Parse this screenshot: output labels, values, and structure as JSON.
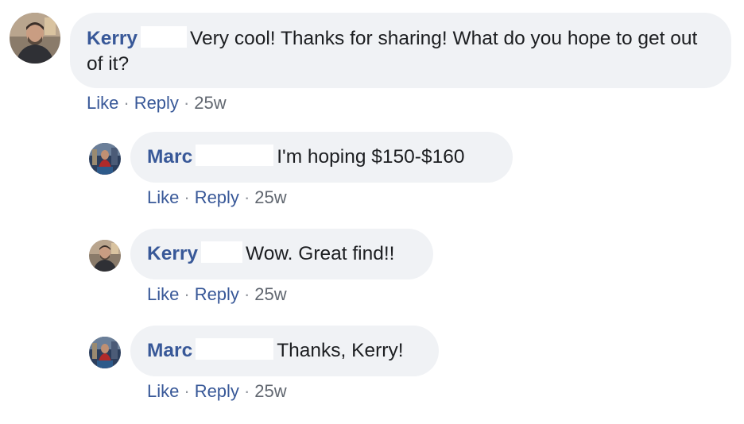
{
  "comments": [
    {
      "author": "Kerry",
      "text": "Very cool! Thanks for sharing! What do you hope to get out of it?",
      "actions": {
        "like": "Like",
        "reply": "Reply",
        "time": "25w"
      }
    },
    {
      "author": "Marc",
      "text": "I'm hoping $150-$160",
      "actions": {
        "like": "Like",
        "reply": "Reply",
        "time": "25w"
      }
    },
    {
      "author": "Kerry",
      "text": "Wow. Great find!!",
      "actions": {
        "like": "Like",
        "reply": "Reply",
        "time": "25w"
      }
    },
    {
      "author": "Marc",
      "text": "Thanks, Kerry!",
      "actions": {
        "like": "Like",
        "reply": "Reply",
        "time": "25w"
      }
    }
  ],
  "separator": "·",
  "colors": {
    "bubble": "#f0f2f5",
    "author": "#385898",
    "text": "#1c1e21",
    "meta": "#616770"
  },
  "icons": {
    "avatar_kerry": "avatar-kerry-icon",
    "avatar_marc": "avatar-marc-icon"
  }
}
